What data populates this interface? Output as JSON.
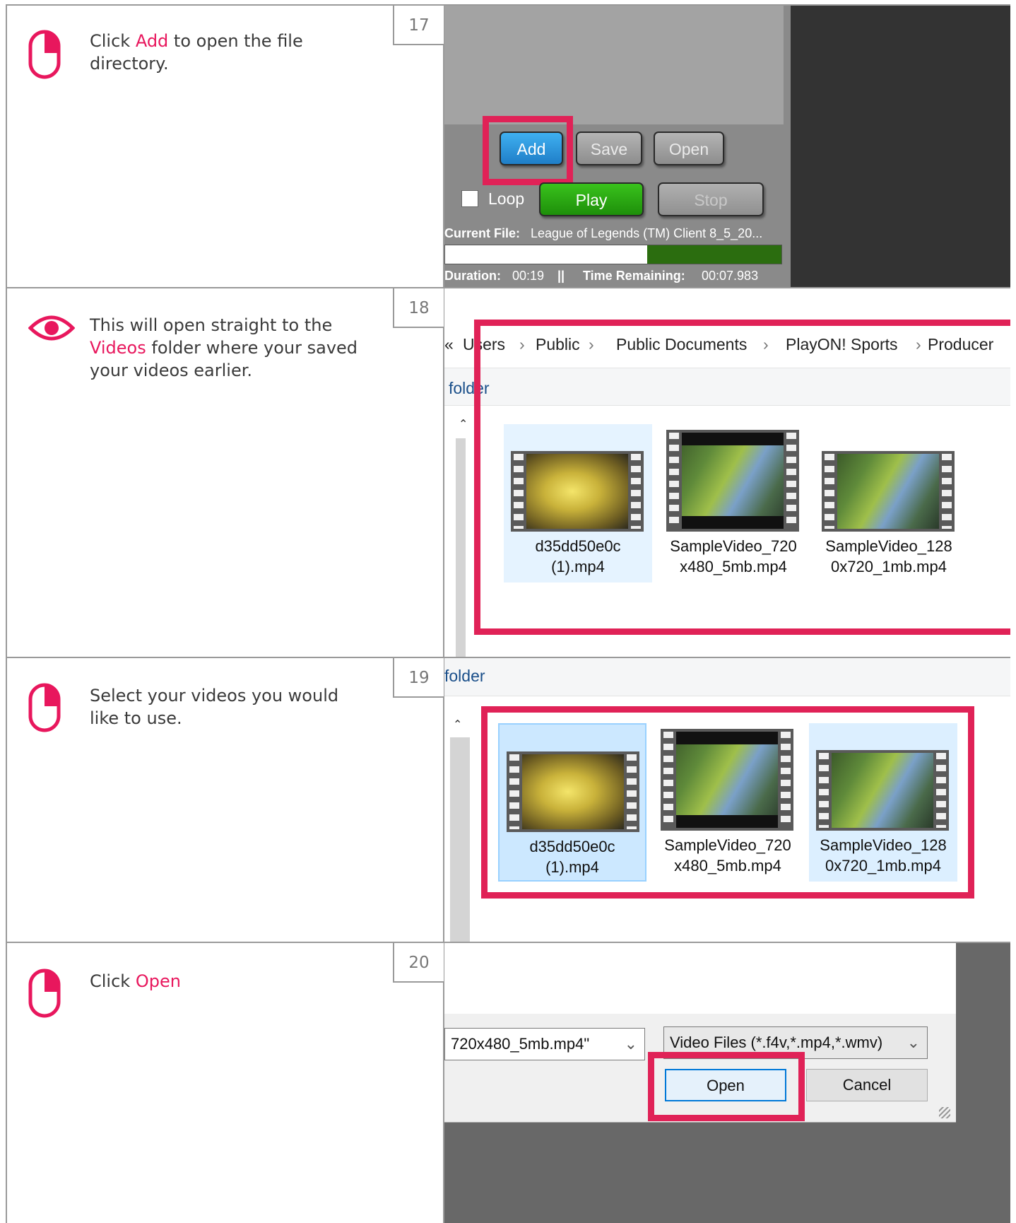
{
  "steps": [
    {
      "number": "17",
      "icon": "mouse-icon",
      "text_pre": "Click ",
      "text_hl": "Add",
      "text_post": " to open the file directory.",
      "app": {
        "add_label": "Add",
        "save_label": "Save",
        "open_label": "Open",
        "loop_label": "Loop",
        "play_label": "Play",
        "stop_label": "Stop",
        "current_file_label": "Current File:",
        "current_file_value": "League of Legends (TM) Client 8_5_20...",
        "duration_label": "Duration:",
        "duration_value": "00:19",
        "separator": "||",
        "remaining_label": "Time Remaining:",
        "remaining_value": "00:07.983",
        "progress_fraction": 0.6
      }
    },
    {
      "number": "18",
      "icon": "eye-icon",
      "text_pre": "This will open straight to the ",
      "text_hl": "Videos",
      "text_post": " folder where your saved your videos earlier.",
      "explorer": {
        "crumbs_start": "«",
        "crumbs": [
          "Users",
          "Public",
          "Public Documents",
          "PlayON! Sports",
          "Producer"
        ],
        "crumb_sep": "›",
        "toolbar_text": "folder",
        "files": [
          {
            "line1": "d35dd50e0c",
            "line2": "(1).mp4"
          },
          {
            "line1": "SampleVideo_720",
            "line2": "x480_5mb.mp4"
          },
          {
            "line1": "SampleVideo_128",
            "line2": "0x720_1mb.mp4"
          }
        ]
      }
    },
    {
      "number": "19",
      "icon": "mouse-icon",
      "text_pre": "Select your videos you would like to use.",
      "text_hl": "",
      "text_post": "",
      "explorer": {
        "toolbar_text": "folder",
        "files": [
          {
            "line1": "d35dd50e0c",
            "line2": "(1).mp4"
          },
          {
            "line1": "SampleVideo_720",
            "line2": "x480_5mb.mp4"
          },
          {
            "line1": "SampleVideo_128",
            "line2": "0x720_1mb.mp4"
          }
        ]
      }
    },
    {
      "number": "20",
      "icon": "mouse-icon",
      "text_pre": "Click ",
      "text_hl": "Open",
      "text_post": "",
      "dialog": {
        "filename_value": "720x480_5mb.mp4\"",
        "filetype_value": "Video Files (*.f4v,*.mp4,*.wmv)",
        "open_label": "Open",
        "cancel_label": "Cancel"
      }
    }
  ],
  "colors": {
    "accent": "#e8175d",
    "highlight_box": "#e02257",
    "border": "#9a9a9a"
  }
}
